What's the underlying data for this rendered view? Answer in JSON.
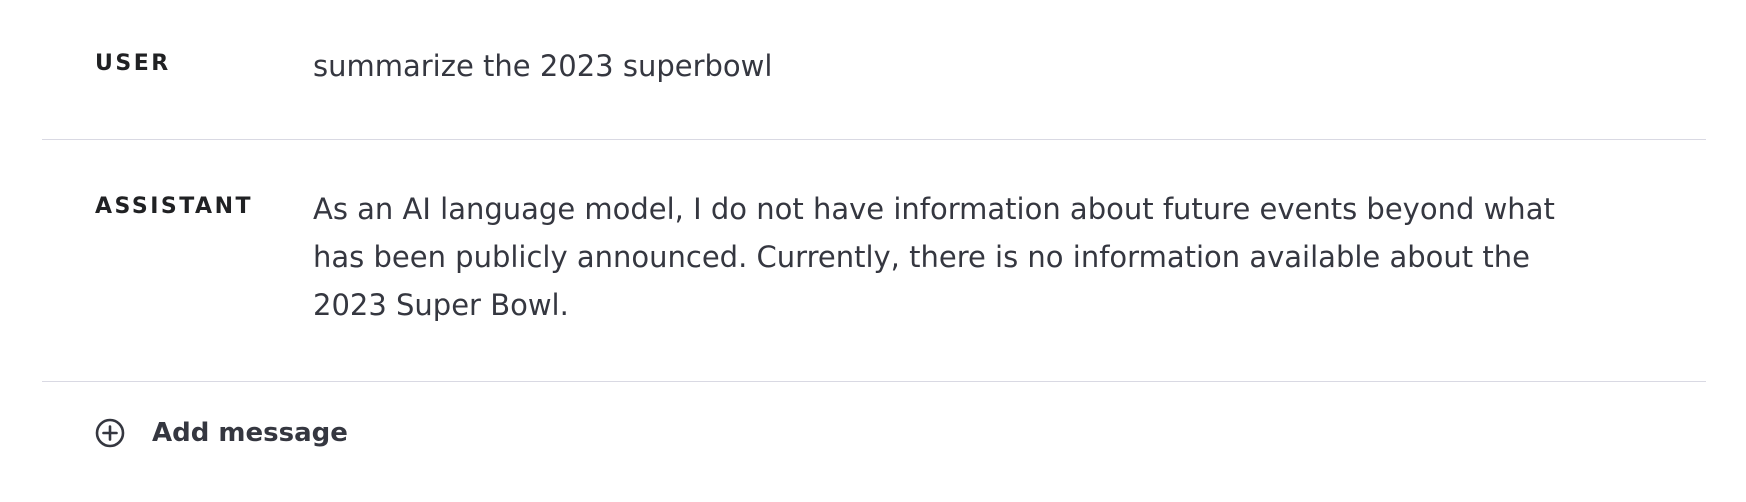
{
  "messages": [
    {
      "role": "USER",
      "text": "summarize the 2023 superbowl"
    },
    {
      "role": "ASSISTANT",
      "text": "As an AI language model, I do not have information about future events beyond what has been publicly announced. Currently, there is no information available about the 2023 Super Bowl."
    }
  ],
  "add_message": {
    "label": "Add message",
    "icon": "plus-circle-icon"
  },
  "colors": {
    "text": "#353740",
    "label": "#202123",
    "divider": "#d9d9e3",
    "background": "#ffffff"
  }
}
